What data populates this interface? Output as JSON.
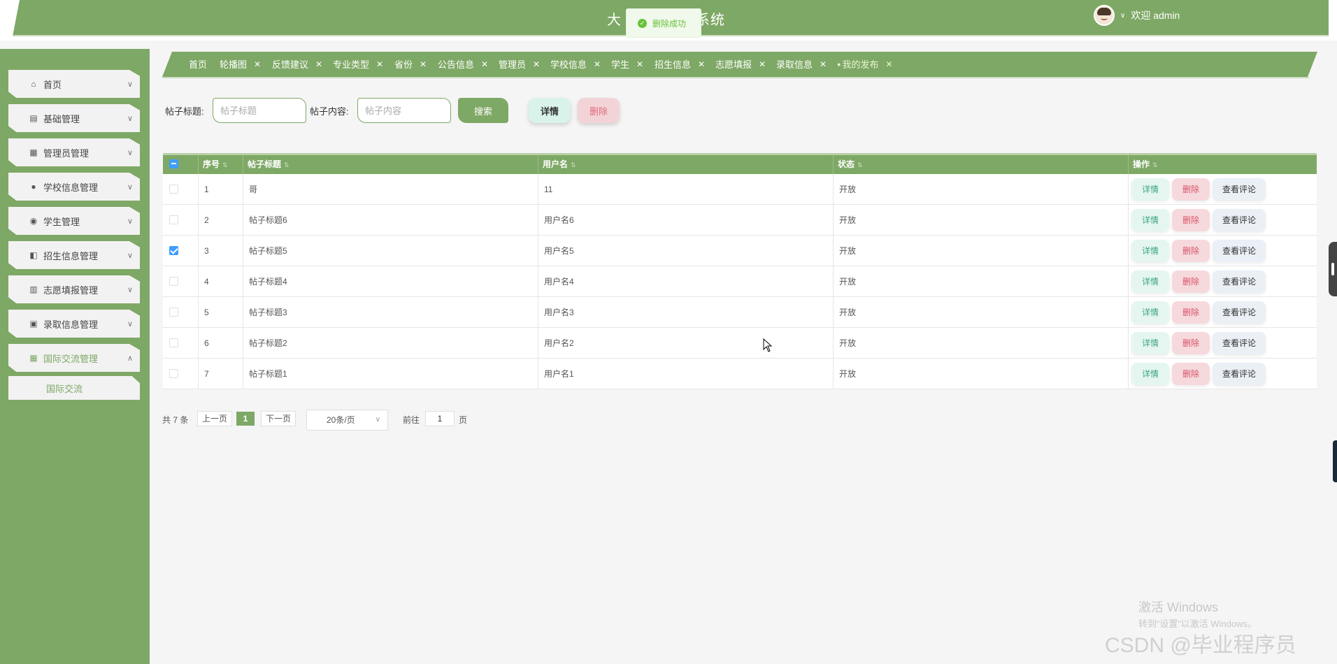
{
  "header": {
    "title_visible": "系统",
    "title_partial": "大",
    "user_greeting": "欢迎 admin"
  },
  "toast": {
    "message": "删除成功"
  },
  "sidebar": {
    "items": [
      {
        "label": "首页",
        "icon": "home-icon"
      },
      {
        "label": "基础管理",
        "icon": "server-icon"
      },
      {
        "label": "管理员管理",
        "icon": "dashboard-icon"
      },
      {
        "label": "学校信息管理",
        "icon": "user-icon"
      },
      {
        "label": "学生管理",
        "icon": "student-icon"
      },
      {
        "label": "招生信息管理",
        "icon": "book-icon"
      },
      {
        "label": "志愿填报管理",
        "icon": "table-icon"
      },
      {
        "label": "录取信息管理",
        "icon": "gift-icon"
      },
      {
        "label": "国际交流管理",
        "icon": "grid-icon"
      }
    ],
    "sub_item": "国际交流"
  },
  "tags": [
    "首页",
    "轮播图",
    "反馈建议",
    "专业类型",
    "省份",
    "公告信息",
    "管理员",
    "学校信息",
    "学生",
    "招生信息",
    "志愿填报",
    "录取信息",
    "我的发布"
  ],
  "search": {
    "title_label": "帖子标题:",
    "title_placeholder": "帖子标题",
    "content_label": "帖子内容:",
    "content_placeholder": "帖子内容",
    "search_button": "搜索",
    "detail_button": "详情",
    "delete_button": "删除"
  },
  "table": {
    "columns": [
      "序号",
      "帖子标题",
      "用户名",
      "状态",
      "操作"
    ],
    "rows": [
      {
        "no": "1",
        "title": "哥",
        "user": "11",
        "status": "开放",
        "checked": false
      },
      {
        "no": "2",
        "title": "帖子标题6",
        "user": "用户名6",
        "status": "开放",
        "checked": false
      },
      {
        "no": "3",
        "title": "帖子标题5",
        "user": "用户名5",
        "status": "开放",
        "checked": true
      },
      {
        "no": "4",
        "title": "帖子标题4",
        "user": "用户名4",
        "status": "开放",
        "checked": false
      },
      {
        "no": "5",
        "title": "帖子标题3",
        "user": "用户名3",
        "status": "开放",
        "checked": false
      },
      {
        "no": "6",
        "title": "帖子标题2",
        "user": "用户名2",
        "status": "开放",
        "checked": false
      },
      {
        "no": "7",
        "title": "帖子标题1",
        "user": "用户名1",
        "status": "开放",
        "checked": false
      }
    ],
    "row_actions": {
      "detail": "详情",
      "delete": "删除",
      "comments": "查看评论"
    }
  },
  "pagination": {
    "total": "共 7 条",
    "prev": "上一页",
    "current": "1",
    "next": "下一页",
    "page_size": "20条/页",
    "goto_label": "前往",
    "goto_value": "1",
    "page_suffix": "页"
  },
  "watermarks": {
    "windows_line1": "激活 Windows",
    "windows_line2": "转到“设置”以激活 Windows。",
    "csdn": "CSDN @毕业程序员"
  },
  "colors": {
    "primary": "#7ea865",
    "success": "#67c23a",
    "checkbox": "#409eff"
  }
}
